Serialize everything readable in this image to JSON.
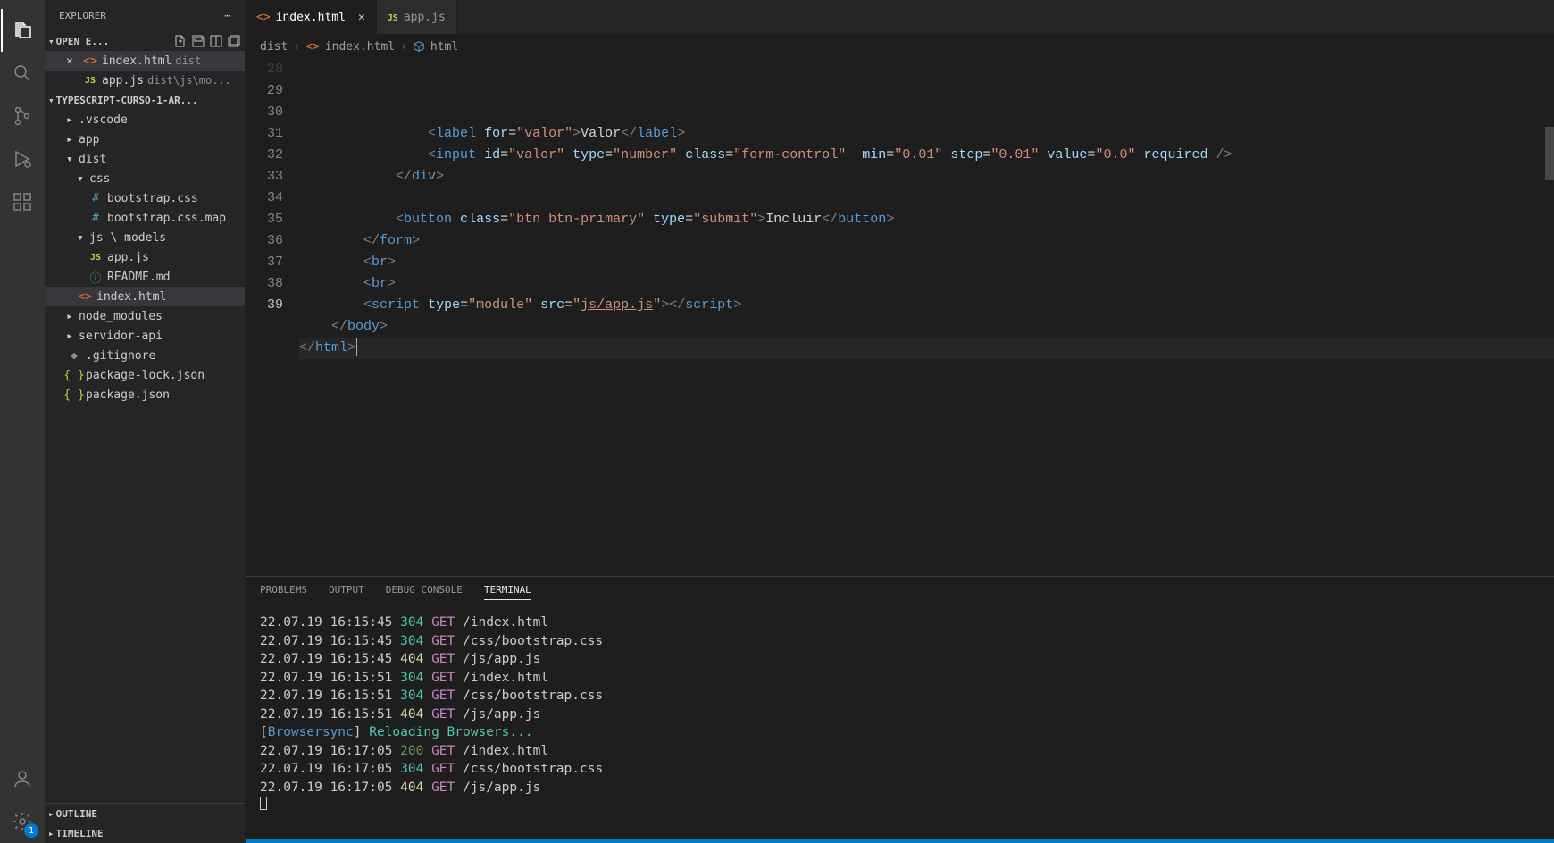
{
  "sidebar": {
    "title": "EXPLORER",
    "openEditors": {
      "title": "OPEN E...",
      "items": [
        {
          "icon": "html",
          "name": "index.html",
          "desc": "dist",
          "active": true,
          "close": true
        },
        {
          "icon": "js",
          "name": "app.js",
          "desc": "dist\\js\\mo...",
          "active": false,
          "close": false
        }
      ]
    },
    "project": {
      "title": "TYPESCRIPT-CURSO-1-AR...",
      "tree": [
        {
          "type": "folder",
          "name": ".vscode",
          "indent": 1,
          "expanded": false
        },
        {
          "type": "folder",
          "name": "app",
          "indent": 1,
          "expanded": false
        },
        {
          "type": "folder",
          "name": "dist",
          "indent": 1,
          "expanded": true
        },
        {
          "type": "folder",
          "name": "css",
          "indent": 2,
          "expanded": true
        },
        {
          "type": "file",
          "name": "bootstrap.css",
          "indent": 3,
          "icon": "hash"
        },
        {
          "type": "file",
          "name": "bootstrap.css.map",
          "indent": 3,
          "icon": "hash"
        },
        {
          "type": "folder",
          "name": "js \\ models",
          "indent": 2,
          "expanded": true
        },
        {
          "type": "file",
          "name": "app.js",
          "indent": 3,
          "icon": "js"
        },
        {
          "type": "file",
          "name": "README.md",
          "indent": 3,
          "icon": "info"
        },
        {
          "type": "file",
          "name": "index.html",
          "indent": 2,
          "icon": "html",
          "active": true
        },
        {
          "type": "folder",
          "name": "node_modules",
          "indent": 1,
          "expanded": false
        },
        {
          "type": "folder",
          "name": "servidor-api",
          "indent": 1,
          "expanded": false
        },
        {
          "type": "file",
          "name": ".gitignore",
          "indent": 1,
          "icon": "git"
        },
        {
          "type": "file",
          "name": "package-lock.json",
          "indent": 1,
          "icon": "json"
        },
        {
          "type": "file",
          "name": "package.json",
          "indent": 1,
          "icon": "json"
        }
      ]
    },
    "outline": "OUTLINE",
    "timeline": "TIMELINE"
  },
  "tabs": [
    {
      "icon": "html",
      "name": "index.html",
      "active": true
    },
    {
      "icon": "js",
      "name": "app.js",
      "active": false
    }
  ],
  "breadcrumb": {
    "part1": "dist",
    "part2": "index.html",
    "part3": "html"
  },
  "editor": {
    "startLine": 28,
    "lines": [
      {
        "n": 29,
        "html": "                <span class='c-brkt'>&lt;</span><span class='c-tag'>label</span> <span class='c-attr'>for</span>=<span class='c-str'>\"valor\"</span><span class='c-brkt'>&gt;</span><span class='c-txt'>Valor</span><span class='c-brkt'>&lt;/</span><span class='c-tag'>label</span><span class='c-brkt'>&gt;</span>"
      },
      {
        "n": 30,
        "html": "                <span class='c-brkt'>&lt;</span><span class='c-tag'>input</span> <span class='c-attr'>id</span>=<span class='c-str'>\"valor\"</span> <span class='c-attr'>type</span>=<span class='c-str'>\"number\"</span> <span class='c-attr'>class</span>=<span class='c-str'>\"form-control\"</span>  <span class='c-attr'>min</span>=<span class='c-str'>\"0.01\"</span> <span class='c-attr'>step</span>=<span class='c-str'>\"0.01\"</span> <span class='c-attr'>value</span>=<span class='c-str'>\"0.0\"</span> <span class='c-attr'>required</span> <span class='c-brkt'>/&gt;</span>"
      },
      {
        "n": 31,
        "html": "            <span class='c-brkt'>&lt;/</span><span class='c-tag'>div</span><span class='c-brkt'>&gt;</span>"
      },
      {
        "n": 32,
        "html": ""
      },
      {
        "n": 33,
        "html": "            <span class='c-brkt'>&lt;</span><span class='c-tag'>button</span> <span class='c-attr'>class</span>=<span class='c-str'>\"btn btn-primary\"</span> <span class='c-attr'>type</span>=<span class='c-str'>\"submit\"</span><span class='c-brkt'>&gt;</span><span class='c-txt'>Incluir</span><span class='c-brkt'>&lt;/</span><span class='c-tag'>button</span><span class='c-brkt'>&gt;</span>"
      },
      {
        "n": 34,
        "html": "        <span class='c-brkt'>&lt;/</span><span class='c-tag'>form</span><span class='c-brkt'>&gt;</span>"
      },
      {
        "n": 35,
        "html": "        <span class='c-brkt'>&lt;</span><span class='c-tag'>br</span><span class='c-brkt'>&gt;</span>"
      },
      {
        "n": 36,
        "html": "        <span class='c-brkt'>&lt;</span><span class='c-tag'>br</span><span class='c-brkt'>&gt;</span>"
      },
      {
        "n": 37,
        "html": "        <span class='c-brkt'>&lt;</span><span class='c-tag'>script</span> <span class='c-attr'>type</span>=<span class='c-str'>\"module\"</span> <span class='c-attr'>src</span>=<span class='c-str'>\"</span><span class='c-link'>js/app.js</span><span class='c-str'>\"</span><span class='c-brkt'>&gt;&lt;/</span><span class='c-tag'>script</span><span class='c-brkt'>&gt;</span>"
      },
      {
        "n": 38,
        "html": "    <span class='c-brkt'>&lt;/</span><span class='c-tag'>body</span><span class='c-brkt'>&gt;</span>"
      },
      {
        "n": 39,
        "html": "<span class='c-brkt'>&lt;/</span><span class='c-tag'>html</span><span class='c-brkt'>&gt;</span>",
        "cursor": true
      }
    ]
  },
  "panel": {
    "tabs": {
      "problems": "PROBLEMS",
      "output": "OUTPUT",
      "debug": "DEBUG CONSOLE",
      "terminal": "TERMINAL"
    },
    "terminalLines": [
      {
        "date": "22.07.19 16:15:45",
        "status": "304",
        "cls": "t-304",
        "method": "GET",
        "path": "/index.html"
      },
      {
        "date": "22.07.19 16:15:45",
        "status": "304",
        "cls": "t-304",
        "method": "GET",
        "path": "/css/bootstrap.css"
      },
      {
        "date": "22.07.19 16:15:45",
        "status": "404",
        "cls": "t-404",
        "method": "GET",
        "path": "/js/app.js"
      },
      {
        "date": "22.07.19 16:15:51",
        "status": "304",
        "cls": "t-304",
        "method": "GET",
        "path": "/index.html"
      },
      {
        "date": "22.07.19 16:15:51",
        "status": "304",
        "cls": "t-304",
        "method": "GET",
        "path": "/css/bootstrap.css"
      },
      {
        "date": "22.07.19 16:15:51",
        "status": "404",
        "cls": "t-404",
        "method": "GET",
        "path": "/js/app.js"
      },
      {
        "type": "reload",
        "text1": "Browsersync",
        "text2": "Reloading Browsers..."
      },
      {
        "date": "22.07.19 16:17:05",
        "status": "200",
        "cls": "t-200",
        "method": "GET",
        "path": "/index.html"
      },
      {
        "date": "22.07.19 16:17:05",
        "status": "304",
        "cls": "t-304",
        "method": "GET",
        "path": "/css/bootstrap.css"
      },
      {
        "date": "22.07.19 16:17:05",
        "status": "404",
        "cls": "t-404",
        "method": "GET",
        "path": "/js/app.js"
      }
    ]
  },
  "settingsBadge": "1"
}
